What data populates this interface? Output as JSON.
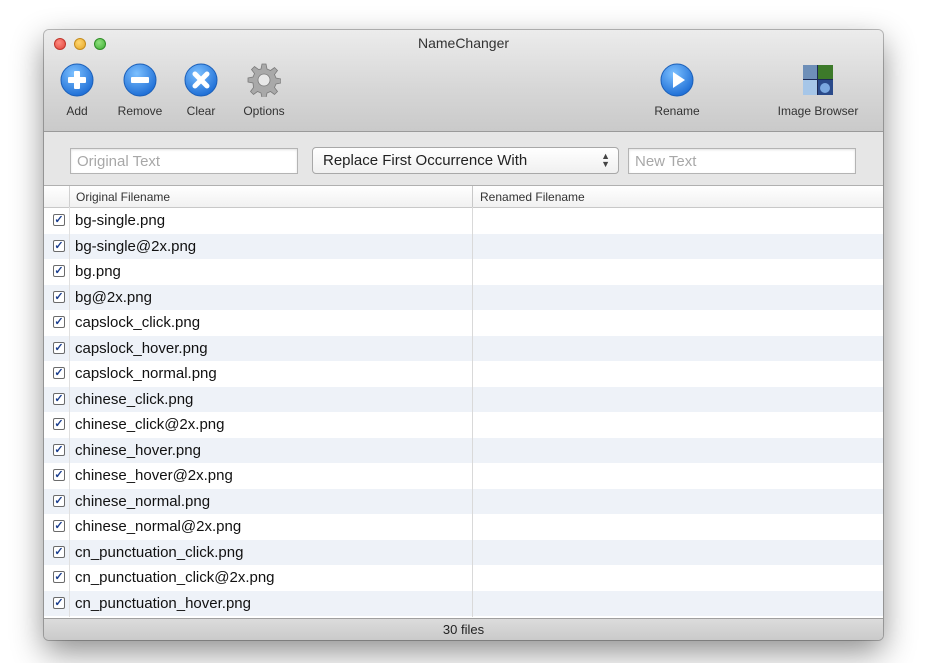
{
  "window": {
    "title": "NameChanger"
  },
  "toolbar": {
    "add_label": "Add",
    "remove_label": "Remove",
    "clear_label": "Clear",
    "options_label": "Options",
    "rename_label": "Rename",
    "image_browser_label": "Image Browser"
  },
  "search": {
    "original_placeholder": "Original Text",
    "original_value": "",
    "mode_selected": "Replace First Occurrence With",
    "new_placeholder": "New Text",
    "new_value": ""
  },
  "table": {
    "columns": [
      "Original Filename",
      "Renamed Filename"
    ],
    "rows": [
      {
        "name": "bg-single.png",
        "checked": true,
        "renamed": ""
      },
      {
        "name": "bg-single@2x.png",
        "checked": true,
        "renamed": ""
      },
      {
        "name": "bg.png",
        "checked": true,
        "renamed": ""
      },
      {
        "name": "bg@2x.png",
        "checked": true,
        "renamed": ""
      },
      {
        "name": "capslock_click.png",
        "checked": true,
        "renamed": ""
      },
      {
        "name": "capslock_hover.png",
        "checked": true,
        "renamed": ""
      },
      {
        "name": "capslock_normal.png",
        "checked": true,
        "renamed": ""
      },
      {
        "name": "chinese_click.png",
        "checked": true,
        "renamed": ""
      },
      {
        "name": "chinese_click@2x.png",
        "checked": true,
        "renamed": ""
      },
      {
        "name": "chinese_hover.png",
        "checked": true,
        "renamed": ""
      },
      {
        "name": "chinese_hover@2x.png",
        "checked": true,
        "renamed": ""
      },
      {
        "name": "chinese_normal.png",
        "checked": true,
        "renamed": ""
      },
      {
        "name": "chinese_normal@2x.png",
        "checked": true,
        "renamed": ""
      },
      {
        "name": "cn_punctuation_click.png",
        "checked": true,
        "renamed": ""
      },
      {
        "name": "cn_punctuation_click@2x.png",
        "checked": true,
        "renamed": ""
      },
      {
        "name": "cn_punctuation_hover.png",
        "checked": true,
        "renamed": ""
      }
    ]
  },
  "status": {
    "file_count": "30 files"
  },
  "icons": {
    "add": "plus-circle-icon",
    "remove": "minus-circle-icon",
    "clear": "x-circle-icon",
    "options": "gear-icon",
    "rename": "play-circle-icon",
    "image_browser": "photo-stack-icon"
  },
  "colors": {
    "accent": "#2f7ad9",
    "row_alt": "#eef2f8"
  }
}
